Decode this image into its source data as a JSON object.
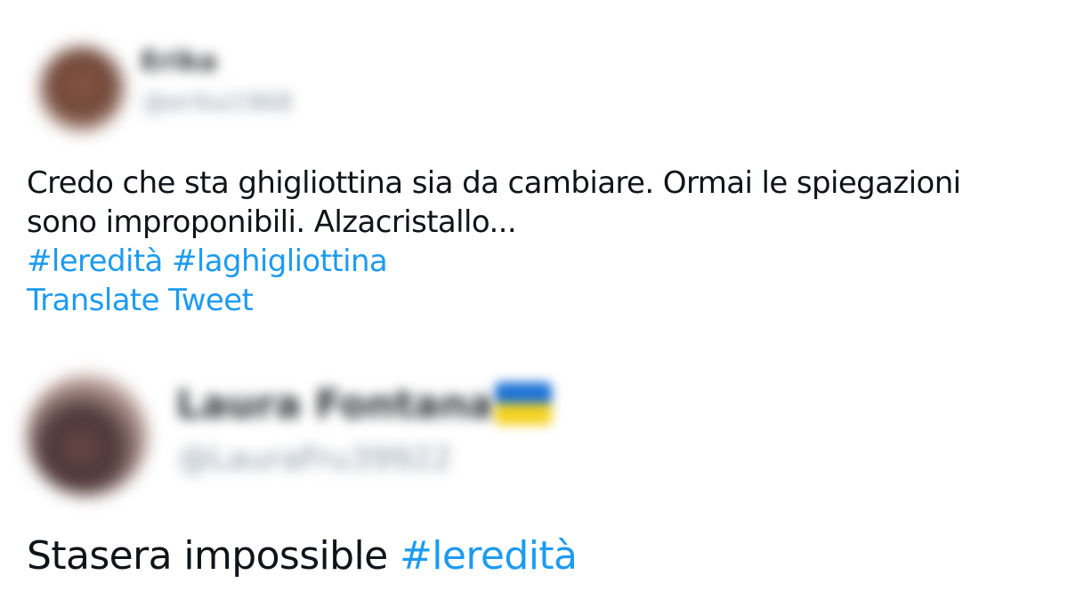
{
  "tweets": [
    {
      "author_name": "Erika",
      "author_handle": "@erika1968",
      "text_lines": [
        "Credo che sta ghigliottina sia da cambiare. Ormai le spiegazioni",
        "sono improponibili. Alzacristallo..."
      ],
      "hashtags": [
        "#leredità",
        "#laghigliottina"
      ],
      "translate_label": "Translate Tweet"
    },
    {
      "author_name": "Laura Fontana",
      "author_handle": "@LauraFru39922",
      "flag_icon": "ukraine-flag-icon",
      "text": "Stasera impossible",
      "hashtags": [
        "#leredità"
      ]
    }
  ],
  "colors": {
    "link": "#1d9bf0",
    "text": "#0f1419",
    "handle": "#8b98a5"
  }
}
